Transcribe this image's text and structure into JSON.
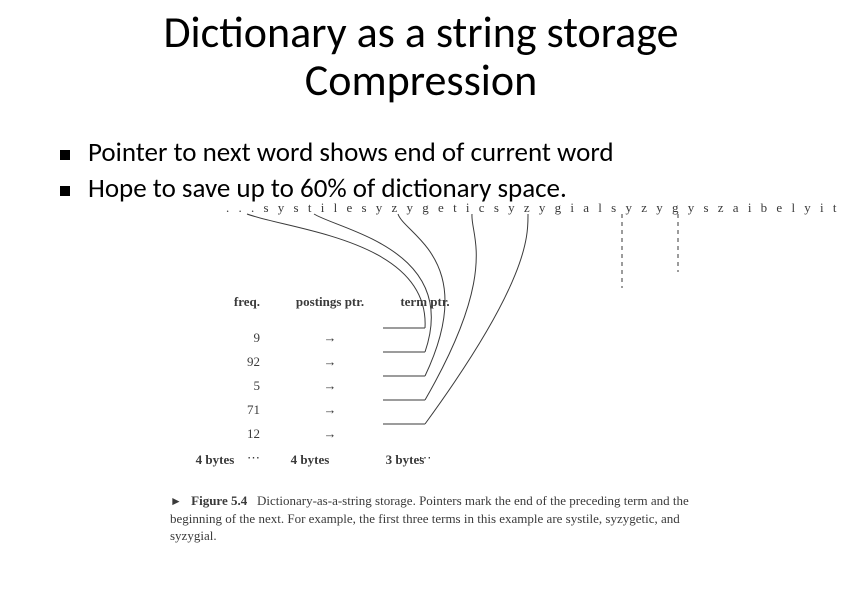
{
  "title_line1": "Dictionary as a string storage",
  "title_line2": "Compression",
  "bullets": [
    "Pointer to next word shows end of current word",
    "Hope to save up to 60% of dictionary space."
  ],
  "longstring": ". . . s y s t i l e s y z y g e t i c s y z y g i a l s y z y g y s z a i b e l y i t e s z e c i n s z o n o . .",
  "headers": {
    "freq": "freq.",
    "postings": "postings ptr.",
    "term": "term ptr."
  },
  "rows": [
    {
      "freq": "9",
      "arrow": "→"
    },
    {
      "freq": "92",
      "arrow": "→"
    },
    {
      "freq": "5",
      "arrow": "→"
    },
    {
      "freq": "71",
      "arrow": "→"
    },
    {
      "freq": "12",
      "arrow": "→"
    }
  ],
  "dotsrow": {
    "c1": "⋯",
    "c3": "⋯"
  },
  "bytes": {
    "b1": "4 bytes",
    "b2": "4 bytes",
    "b3": "3 bytes"
  },
  "caption": {
    "label": "Figure 5.4",
    "text": "Dictionary-as-a-string storage. Pointers mark the end of the preceding term and the beginning of the next. For example, the first three terms in this example are systile, syzygetic, and syzygial."
  }
}
